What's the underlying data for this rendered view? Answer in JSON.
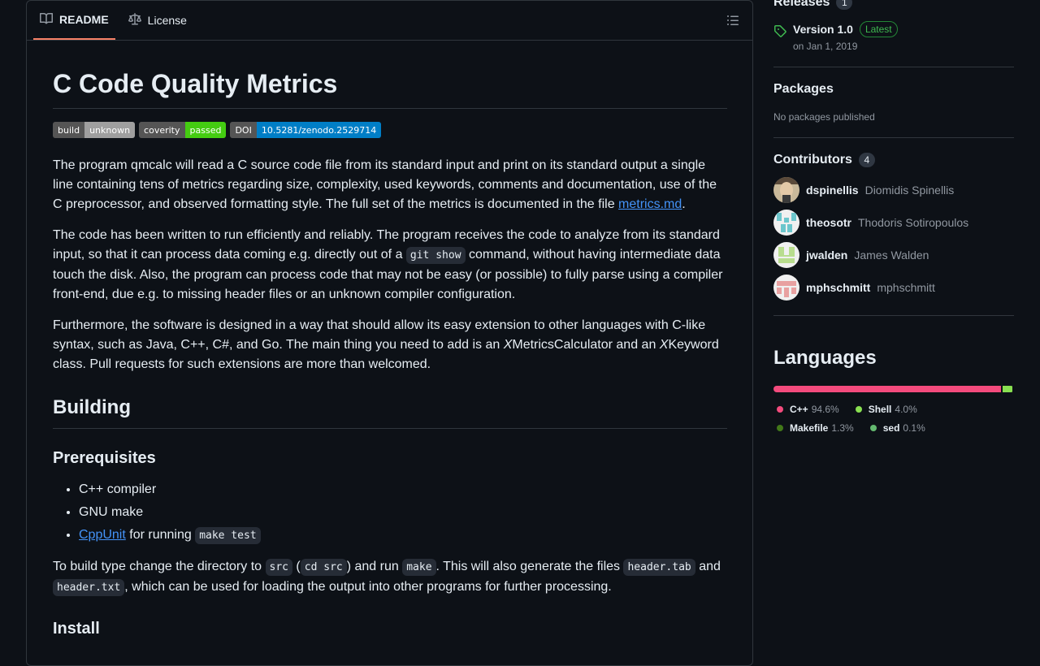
{
  "tabs": [
    {
      "label": "README",
      "icon": "book-icon",
      "active": true
    },
    {
      "label": "License",
      "icon": "law-icon",
      "active": false
    }
  ],
  "readme": {
    "title": "C Code Quality Metrics",
    "badges": [
      {
        "label": "build",
        "value": "unknown",
        "color": "#9f9f9f"
      },
      {
        "label": "coverity",
        "value": "passed",
        "color": "#4c1"
      },
      {
        "label": "DOI",
        "value": "10.5281/zenodo.2529714",
        "color": "#007ec6"
      }
    ],
    "p1": {
      "text": "The program qmcalc will read a C source code file from its standard input and print on its standard output a single line containing tens of metrics regarding size, complexity, used keywords, comments and documentation, use of the C preprocessor, and observed formatting style. The full set of the metrics is documented in the file ",
      "link": "metrics.md",
      "end": "."
    },
    "p2": {
      "a": "The code has been written to run efficiently and reliably. The program receives the code to analyze from its standard input, so that it can process data coming e.g. directly out of a ",
      "code": "git show",
      "b": " command, without having intermediate data touch the disk. Also, the program can process code that may not be easy (or possible) to fully parse using a compiler front-end, due e.g. to missing header files or an unknown compiler configuration."
    },
    "p3": {
      "a": "Furthermore, the software is designed in a way that should allow its easy extension to other languages with C-like syntax, such as Java, C++, C#, and Go. The main thing you need to add is an ",
      "em1": "X",
      "b": "MetricsCalculator and an ",
      "em2": "X",
      "c": "Keyword class. Pull requests for such extensions are more than welcomed."
    },
    "building_heading": "Building",
    "prereq_heading": "Prerequisites",
    "prereqs": {
      "item1": "C++ compiler",
      "item2": "GNU make",
      "item3_link": "CppUnit",
      "item3_text": " for running ",
      "item3_code": "make test"
    },
    "p4": {
      "a": "To build type change the directory to ",
      "code1": "src",
      "b": " (",
      "code2": "cd src",
      "c": ") and run ",
      "code3": "make",
      "d": ". This will also generate the files ",
      "code4": "header.tab",
      "e": " and ",
      "code5": "header.txt",
      "f": ", which can be used for loading the output into other programs for further processing."
    },
    "install_heading": "Install"
  },
  "sidebar": {
    "releases": {
      "heading": "Releases",
      "count": "1",
      "name": "Version 1.0",
      "badge": "Latest",
      "date": "on Jan 1, 2019"
    },
    "packages": {
      "heading": "Packages",
      "text": "No packages published"
    },
    "contributors": {
      "heading": "Contributors",
      "count": "4",
      "people": [
        {
          "login": "dspinellis",
          "name": "Diomidis Spinellis"
        },
        {
          "login": "theosotr",
          "name": "Thodoris Sotiropoulos"
        },
        {
          "login": "jwalden",
          "name": "James Walden"
        },
        {
          "login": "mphschmitt",
          "name": "mphschmitt"
        }
      ]
    },
    "languages": {
      "heading": "Languages",
      "list": [
        {
          "name": "C++",
          "percent": "94.6%",
          "value": 94.6,
          "color": "#f34b7d"
        },
        {
          "name": "Shell",
          "percent": "4.0%",
          "value": 4.0,
          "color": "#89e051"
        },
        {
          "name": "Makefile",
          "percent": "1.3%",
          "value": 1.3,
          "color": "#427819"
        },
        {
          "name": "sed",
          "percent": "0.1%",
          "value": 0.1,
          "color": "#64b970"
        }
      ]
    }
  }
}
